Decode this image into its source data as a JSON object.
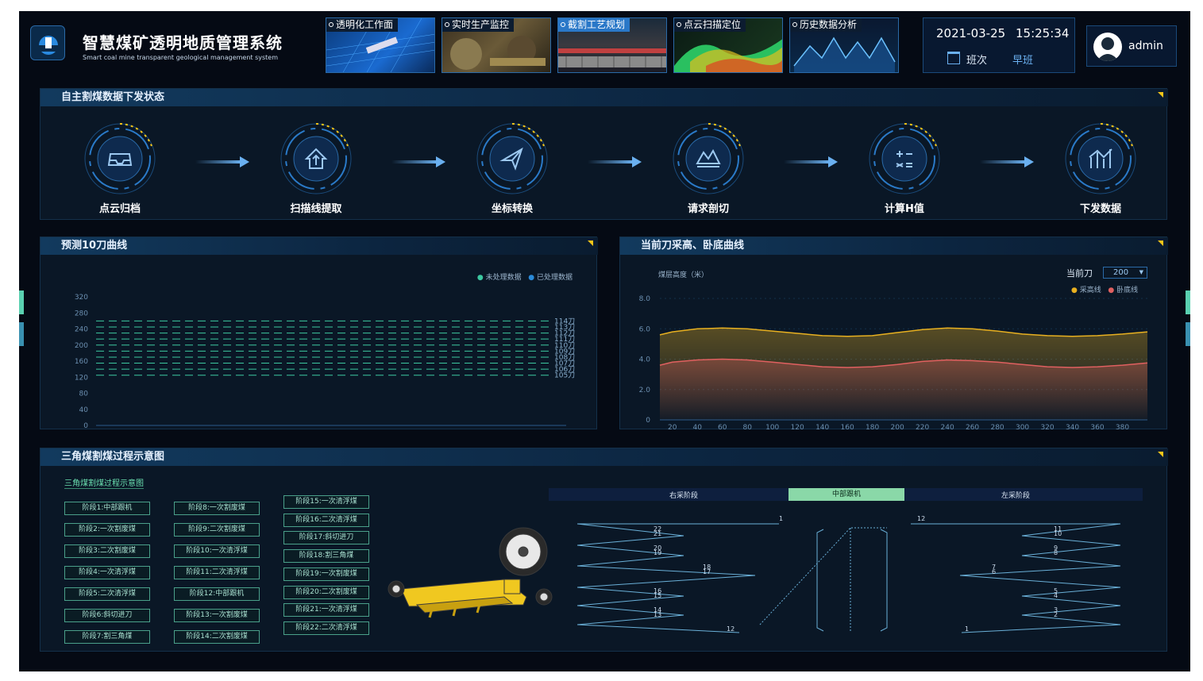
{
  "header": {
    "title_cn": "智慧煤矿透明地质管理系统",
    "title_en": "Smart coal mine transparent geological management system",
    "date": "2021-03-25",
    "time": "15:25:34",
    "shift_label": "班次",
    "shift_value": "早班",
    "user": "admin"
  },
  "tabs": [
    {
      "label": "透明化工作面",
      "active": false
    },
    {
      "label": "实时生产监控",
      "active": false
    },
    {
      "label": "截割工艺规划",
      "active": true
    },
    {
      "label": "点云扫描定位",
      "active": false
    },
    {
      "label": "历史数据分析",
      "active": false
    }
  ],
  "flow": {
    "title": "自主割煤数据下发状态",
    "steps": [
      {
        "label": "点云归档",
        "icon": "inbox-icon"
      },
      {
        "label": "扫描线提取",
        "icon": "upload-icon"
      },
      {
        "label": "坐标转换",
        "icon": "send-icon"
      },
      {
        "label": "请求剖切",
        "icon": "terrain-icon"
      },
      {
        "label": "计算H值",
        "icon": "calculator-icon"
      },
      {
        "label": "下发数据",
        "icon": "bar-chart-icon"
      }
    ]
  },
  "predict": {
    "title": "预测10刀曲线",
    "legend_unprocessed": "未处理数据",
    "legend_processed": "已处理数据",
    "colors": {
      "unprocessed": "#3cc8a0",
      "processed": "#2a8ad8"
    }
  },
  "height": {
    "title": "当前刀采高、卧底曲线",
    "ylabel": "煤层高度（米）",
    "current_label": "当前刀",
    "current_value": "200",
    "legend_mining": "采高线",
    "legend_floor": "卧底线",
    "colors": {
      "mining": "#e8b020",
      "floor": "#e06060"
    }
  },
  "chart_data": [
    {
      "type": "line",
      "yticks": [
        "320",
        "280",
        "240",
        "200",
        "160",
        "120",
        "80",
        "40",
        "0"
      ],
      "ylim": [
        0,
        320
      ],
      "series": [
        {
          "name": "114刀",
          "values": [
            260
          ]
        },
        {
          "name": "113刀",
          "values": [
            245
          ]
        },
        {
          "name": "112刀",
          "values": [
            230
          ]
        },
        {
          "name": "111刀",
          "values": [
            215
          ]
        },
        {
          "name": "110刀",
          "values": [
            200
          ]
        },
        {
          "name": "109刀",
          "values": [
            185
          ]
        },
        {
          "name": "108刀",
          "values": [
            170
          ]
        },
        {
          "name": "107刀",
          "values": [
            155
          ]
        },
        {
          "name": "106刀",
          "values": [
            140
          ]
        },
        {
          "name": "105刀",
          "values": [
            125
          ]
        }
      ]
    },
    {
      "type": "area",
      "x": [
        10,
        20,
        40,
        60,
        80,
        100,
        120,
        140,
        160,
        180,
        200,
        220,
        240,
        260,
        280,
        300,
        320,
        340,
        360,
        380,
        400
      ],
      "xticks": [
        "20",
        "40",
        "60",
        "80",
        "100",
        "120",
        "140",
        "160",
        "180",
        "200",
        "220",
        "240",
        "260",
        "280",
        "300",
        "320",
        "340",
        "360",
        "380"
      ],
      "yticks": [
        "8.0",
        "6.0",
        "4.0",
        "2.0",
        "0"
      ],
      "ylim": [
        0,
        8
      ],
      "series": [
        {
          "name": "采高线",
          "values": [
            5.6,
            5.8,
            6.0,
            6.05,
            6.0,
            5.85,
            5.7,
            5.55,
            5.5,
            5.55,
            5.75,
            5.95,
            6.05,
            6.0,
            5.85,
            5.65,
            5.55,
            5.5,
            5.55,
            5.65,
            5.8
          ]
        },
        {
          "name": "卧底线",
          "values": [
            3.6,
            3.8,
            3.95,
            4.0,
            3.95,
            3.8,
            3.65,
            3.5,
            3.45,
            3.5,
            3.65,
            3.85,
            3.95,
            3.9,
            3.8,
            3.65,
            3.5,
            3.45,
            3.5,
            3.6,
            3.75
          ]
        }
      ]
    }
  ],
  "triangle": {
    "title": "三角煤割煤过程示意图",
    "subtitle": "三角煤割煤过程示意图",
    "stages": [
      "阶段1:中部跟机",
      "阶段2:一次割废煤",
      "阶段3:二次割废煤",
      "阶段4:一次清浮煤",
      "阶段5:二次清浮煤",
      "阶段6:斜切进刀",
      "阶段7:割三角煤",
      "阶段8:一次割废煤",
      "阶段9:二次割废煤",
      "阶段10:一次清浮煤",
      "阶段11:二次清浮煤",
      "阶段12:中部跟机",
      "阶段13:一次割废煤",
      "阶段14:二次割废煤",
      "阶段15:一次清浮煤",
      "阶段16:二次清浮煤",
      "阶段17:斜切进刀",
      "阶段18:割三角煤",
      "阶段19:一次割废煤",
      "阶段20:二次割废煤",
      "阶段21:一次清浮煤",
      "阶段22:二次清浮煤"
    ],
    "sections": {
      "right": "右采阶段",
      "middle": "中部跟机",
      "left": "左采阶段"
    },
    "left_numbers": [
      "1",
      "22",
      "21",
      "20",
      "19",
      "18",
      "17",
      "16",
      "15",
      "14",
      "13",
      "12"
    ],
    "right_numbers": [
      "12",
      "11",
      "10",
      "9",
      "8",
      "7",
      "6",
      "5",
      "4",
      "3",
      "2",
      "1"
    ]
  }
}
